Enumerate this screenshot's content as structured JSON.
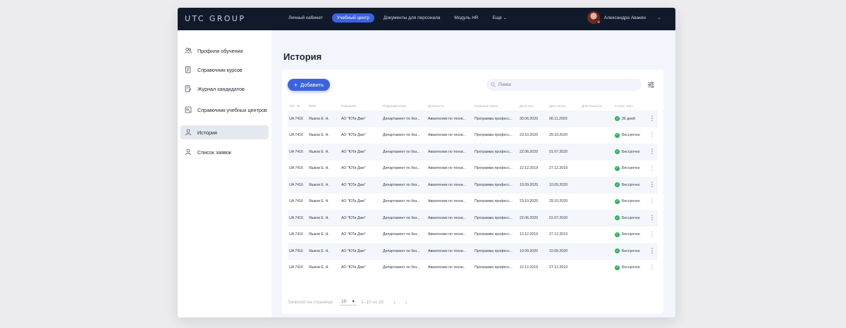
{
  "app": {
    "logo": "UTC GROUP",
    "nav": [
      {
        "label": "Личный кабинет"
      },
      {
        "label": "Учебный центр"
      },
      {
        "label": "Документы для персонала"
      },
      {
        "label": "Модуль HR"
      },
      {
        "label": "Еще"
      }
    ],
    "user": {
      "name": "Александра Авакян"
    }
  },
  "sidebar": {
    "items": [
      {
        "label": "Профили обучения",
        "icon": "users-icon"
      },
      {
        "label": "Справочник курсов",
        "icon": "book-icon"
      },
      {
        "label": "Журнал кандидатов",
        "icon": "journal-icon"
      },
      {
        "label": "Справочник учебных центров",
        "icon": "center-icon"
      },
      {
        "label": "История",
        "icon": "user-icon",
        "active": true
      },
      {
        "label": "Список заявок",
        "icon": "user-icon"
      }
    ]
  },
  "page": {
    "title": "История"
  },
  "toolbar": {
    "add_label": "Добавить",
    "search_placeholder": "Поиск"
  },
  "table": {
    "headers": [
      "Таб. №",
      "ФИО",
      "Компания",
      "Подразделение",
      "Должность",
      "Название курса",
      "Дата нач.",
      "Дата оконч.",
      "Длительность",
      "Статус серт."
    ],
    "rows": [
      [
        "UA 7416",
        "Яшков Е. Н.",
        "АО \"ЮТи Джи\"",
        "Департамент по без...",
        "Авиатехник по техни...",
        "Программа професс...",
        "30.06.2020",
        "06.11.2020",
        "",
        "36 дней"
      ],
      [
        "UA 7416",
        "Яшков Е. Н.",
        "АО \"ЮТи Джи\"",
        "Департамент по без...",
        "Авиатехник по техни...",
        "Программа професс...",
        "23.10.2020",
        "29.10.2020",
        "",
        "Бессрочно"
      ],
      [
        "UA 7416",
        "Яшков Е. Н.",
        "АО \"ЮТи Джи\"",
        "Департамент по без...",
        "Авиатехник по техни...",
        "Программа професс...",
        "22.06.2020",
        "01.07.2020",
        "",
        "Бессрочно"
      ],
      [
        "UA 7416",
        "Яшков Е. Н.",
        "АО \"ЮТи Джи\"",
        "Департамент по без...",
        "Авиатехник по техни...",
        "Программа професс...",
        "12.12.2019",
        "27.12.2019",
        "",
        "Бессрочно"
      ],
      [
        "UA 7416",
        "Яшков Е. Н.",
        "АО \"ЮТи Джи\"",
        "Департамент по без...",
        "Авиатехник по техни...",
        "Программа професс...",
        "10.09.2020",
        "10.09.2020",
        "",
        "Бессрочно"
      ],
      [
        "UA 7416",
        "Яшков Е. Н.",
        "АО \"ЮТи Джи\"",
        "Департамент по без...",
        "Авиатехник по техни...",
        "Программа професс...",
        "23.10.2020",
        "29.10.2020",
        "",
        "Бессрочно"
      ],
      [
        "UA 7416",
        "Яшков Е. Н.",
        "АО \"ЮТи Джи\"",
        "Департамент по без...",
        "Авиатехник по техни...",
        "Программа професс...",
        "22.06.2020",
        "01.07.2020",
        "",
        "Бессрочно"
      ],
      [
        "UA 7416",
        "Яшков Е. Н.",
        "АО \"ЮТи Джи\"",
        "Департамент по без...",
        "Авиатехник по техни...",
        "Программа професс...",
        "12.12.2019",
        "27.12.2019",
        "",
        "Бессрочно"
      ],
      [
        "UA 7416",
        "Яшков Е. Н.",
        "АО \"ЮТи Джи\"",
        "Департамент по без...",
        "Авиатехник по техни...",
        "Программа професс...",
        "10.09.2020",
        "10.09.2020",
        "",
        "Бессрочно"
      ],
      [
        "UA 7416",
        "Яшков Е. Н.",
        "АО \"ЮТи Джи\"",
        "Департамент по без...",
        "Авиатехник по техни...",
        "Программа професс...",
        "12.12.2019",
        "27.12.2019",
        "",
        "Бессрочно"
      ]
    ]
  },
  "pagination": {
    "label": "Записей на странице",
    "per_page": "10",
    "range": "1–10 из 35",
    "prev": "‹",
    "next": "›"
  },
  "colors": {
    "accent": "#3b63e0",
    "topbar": "#101a2b",
    "status_ok": "#2fb35a"
  }
}
